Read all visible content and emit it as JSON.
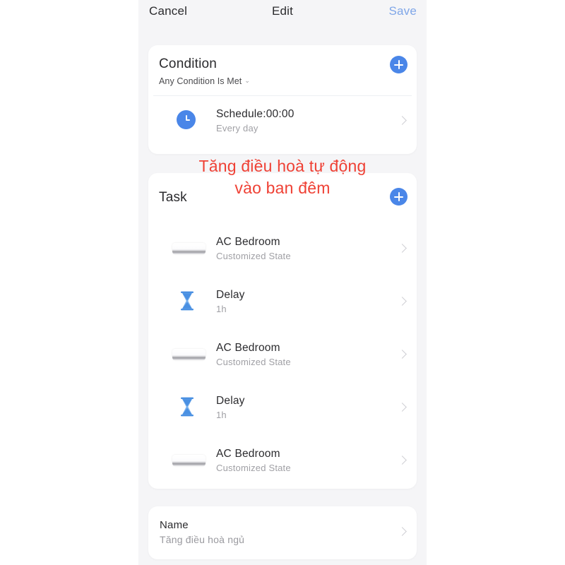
{
  "navbar": {
    "cancel_label": "Cancel",
    "title": "Edit",
    "save_label": "Save",
    "save_color": "#7fa6e8"
  },
  "condition_card": {
    "title": "Condition",
    "subtitle": "Any Condition Is Met",
    "dropdown_glyph": "⌄",
    "add_button_label": "+",
    "rows": [
      {
        "icon": "clock-icon",
        "title": "Schedule:00:00",
        "subtitle": "Every day",
        "chevron": "chevron-right-icon"
      }
    ]
  },
  "task_card": {
    "title": "Task",
    "add_button_label": "+",
    "rows": [
      {
        "icon": "air-conditioner-icon",
        "title": "AC Bedroom",
        "subtitle": "Customized State",
        "chevron": "chevron-right-icon"
      },
      {
        "icon": "hourglass-icon",
        "title": "Delay",
        "subtitle": "1h",
        "chevron": "chevron-right-icon"
      },
      {
        "icon": "air-conditioner-icon",
        "title": "AC Bedroom",
        "subtitle": "Customized State",
        "chevron": "chevron-right-icon"
      },
      {
        "icon": "hourglass-icon",
        "title": "Delay",
        "subtitle": "1h",
        "chevron": "chevron-right-icon"
      },
      {
        "icon": "air-conditioner-icon",
        "title": "AC Bedroom",
        "subtitle": "Customized State",
        "chevron": "chevron-right-icon"
      }
    ]
  },
  "name_card": {
    "label": "Name",
    "value": "Tăng điều hoà ngủ",
    "chevron": "chevron-right-icon"
  },
  "annotation": {
    "line1": "Tăng điều hoà tự động",
    "line2": "vào ban đêm",
    "color": "#ef4135"
  },
  "theme": {
    "accent_blue": "#4a86e8",
    "screen_background": "#f5f5f7",
    "card_background": "#ffffff",
    "primary_text": "#2b2b2e",
    "secondary_text": "#a0a0a5"
  }
}
